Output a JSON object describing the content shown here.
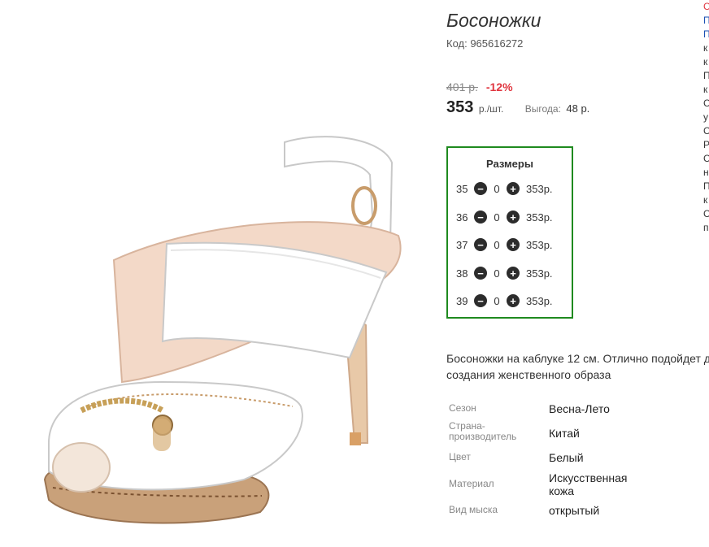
{
  "product": {
    "title": "Босоножки",
    "code": "Код: 965616272",
    "old_price": "401 р.",
    "discount": "-12%",
    "price": "353",
    "price_unit": "р./шт.",
    "savings_label": "Выгода:",
    "savings_value": "48 р."
  },
  "sizes": {
    "title": "Размеры",
    "rows": [
      {
        "size": "35",
        "qty": "0",
        "price": "353р."
      },
      {
        "size": "36",
        "qty": "0",
        "price": "353р."
      },
      {
        "size": "37",
        "qty": "0",
        "price": "353р."
      },
      {
        "size": "38",
        "qty": "0",
        "price": "353р."
      },
      {
        "size": "39",
        "qty": "0",
        "price": "353р."
      }
    ],
    "minus_icon": "−",
    "plus_icon": "+"
  },
  "description": {
    "line1": "Босоножки на каблуке 12 см. Отлично подойдет д",
    "line2": "создания женственного образа"
  },
  "specs": [
    {
      "label": "Сезон",
      "value": "Весна-Лето"
    },
    {
      "label": "Страна-производитель",
      "value": "Китай"
    },
    {
      "label": "Цвет",
      "value": "Белый"
    },
    {
      "label": "Материал",
      "value": "Искусственная кожа"
    },
    {
      "label": "Вид мыска",
      "value": "открытый"
    }
  ],
  "side_fragment": [
    "С",
    "П",
    "П",
    "к",
    "к",
    "П",
    "к",
    "С",
    "у",
    "С",
    "Р",
    "С",
    "н",
    "П",
    "к",
    "С",
    "п"
  ],
  "colors": {
    "sizes_border": "#1f8a1f",
    "discount": "#e0353f"
  }
}
